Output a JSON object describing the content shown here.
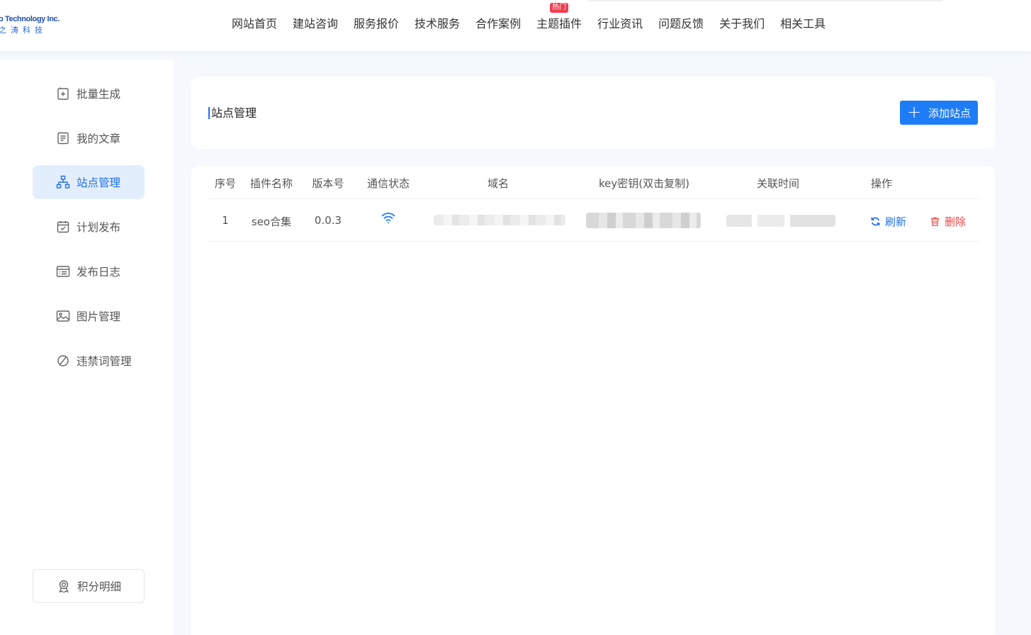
{
  "header": {
    "logo_en": "o Technology Inc.",
    "logo_cn": "之涛科技",
    "nav": [
      {
        "label": "网站首页"
      },
      {
        "label": "建站咨询"
      },
      {
        "label": "服务报价"
      },
      {
        "label": "技术服务"
      },
      {
        "label": "合作案例"
      },
      {
        "label": "主题插件",
        "badge": "热门"
      },
      {
        "label": "行业资讯"
      },
      {
        "label": "问题反馈"
      },
      {
        "label": "关于我们"
      },
      {
        "label": "相关工具"
      }
    ]
  },
  "sidebar": {
    "items": [
      {
        "label": "批量生成",
        "icon": "plus-square-icon"
      },
      {
        "label": "我的文章",
        "icon": "document-icon"
      },
      {
        "label": "站点管理",
        "icon": "sitemap-icon",
        "active": true
      },
      {
        "label": "计划发布",
        "icon": "calendar-check-icon"
      },
      {
        "label": "发布日志",
        "icon": "log-icon"
      },
      {
        "label": "图片管理",
        "icon": "image-icon"
      },
      {
        "label": "违禁词管理",
        "icon": "forbidden-icon"
      }
    ],
    "points_label": "积分明细"
  },
  "main": {
    "title": "站点管理",
    "add_label": "添加站点",
    "columns": [
      "序号",
      "插件名称",
      "版本号",
      "通信状态",
      "域名",
      "key密钥(双击复制)",
      "关联时间",
      "操作"
    ],
    "rows": [
      {
        "index": "1",
        "plugin": "seo合集",
        "version": "0.0.3",
        "status_icon": "wifi-icon",
        "refresh_label": "刷新",
        "delete_label": "删除"
      }
    ]
  },
  "colors": {
    "accent": "#1f6fef",
    "danger": "#f04545",
    "hot_badge": "#f23d4f"
  }
}
